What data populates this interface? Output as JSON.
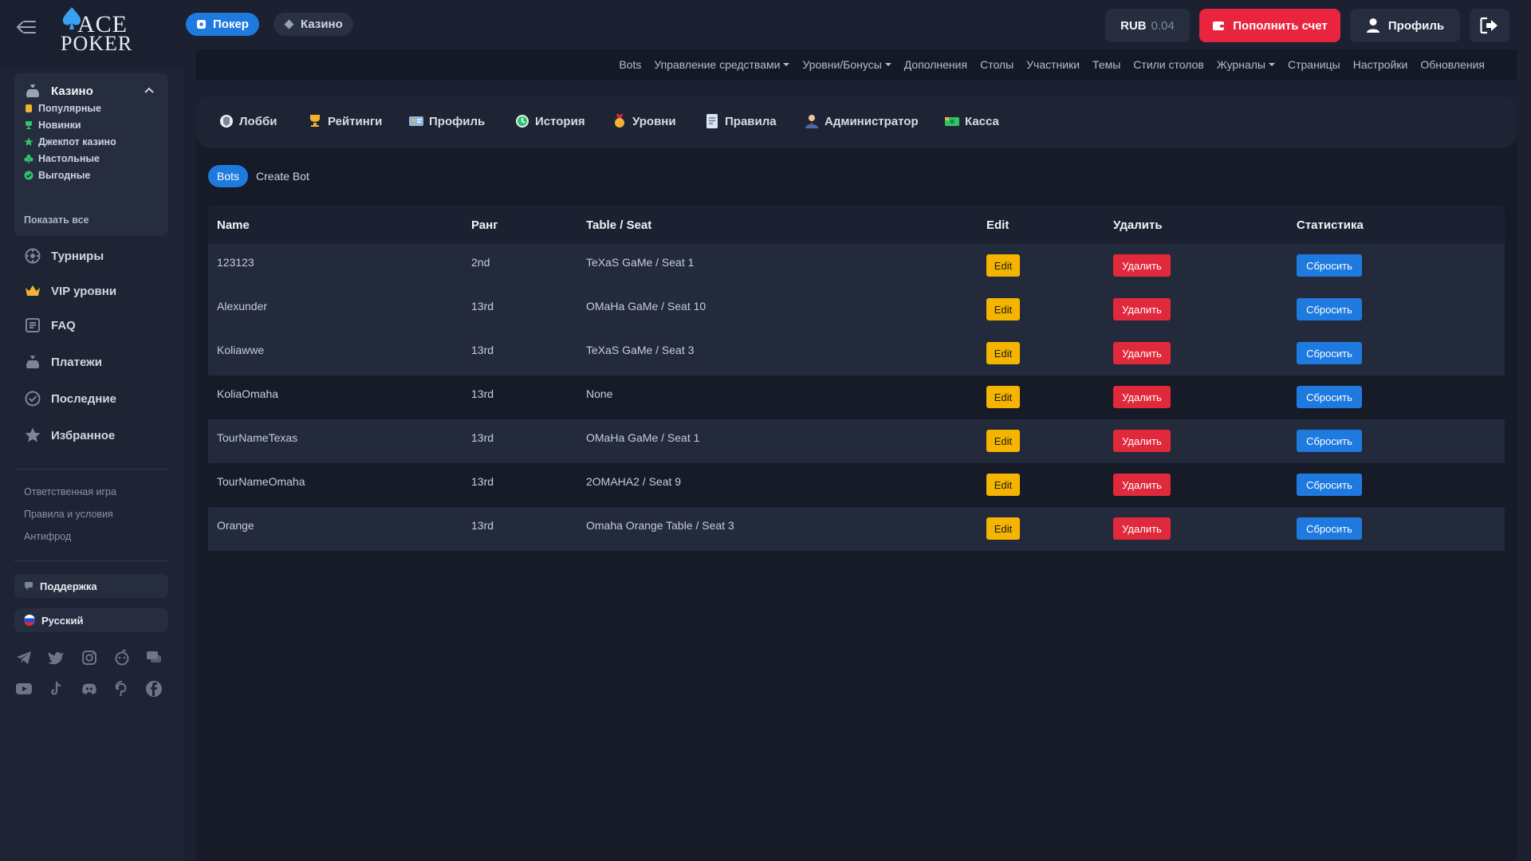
{
  "brand": {
    "logo_top": "ACE",
    "logo_bottom": "POKER"
  },
  "topbar": {
    "tabs": [
      {
        "label": "Покер",
        "icon": "poker-chip-icon"
      },
      {
        "label": "Казино",
        "icon": "diamond-icon"
      }
    ],
    "balance": {
      "currency": "RUB",
      "amount": "0.04"
    },
    "deposit_label": "Пополнить счет",
    "profile_label": "Профиль"
  },
  "sidebar": {
    "casino": {
      "label": "Казино",
      "items": [
        {
          "label": "Популярные",
          "icon": "popular-icon"
        },
        {
          "label": "Новинки",
          "icon": "trophy-icon"
        },
        {
          "label": "Джекпот казино",
          "icon": "star-icon"
        },
        {
          "label": "Настольные",
          "icon": "club-icon"
        },
        {
          "label": "Выгодные",
          "icon": "check-icon"
        }
      ],
      "show_all": "Показать все"
    },
    "nav": [
      {
        "label": "Турниры",
        "icon": "tournament-icon"
      },
      {
        "label": "VIP уровни",
        "icon": "crown-icon"
      },
      {
        "label": "FAQ",
        "icon": "faq-icon"
      },
      {
        "label": "Платежи",
        "icon": "money-bag-icon"
      },
      {
        "label": "Последние",
        "icon": "recent-icon"
      },
      {
        "label": "Избранное",
        "icon": "star-icon"
      }
    ],
    "footer_links": [
      "Ответственная игра",
      "Правила и условия",
      "Антифрод"
    ],
    "support_label": "Поддержка",
    "language_label": "Русский",
    "social_icons": [
      "telegram-icon",
      "twitter-icon",
      "instagram-icon",
      "reddit-icon",
      "chat-icon",
      "youtube-icon",
      "tiktok-icon",
      "discord-icon",
      "pinterest-icon",
      "facebook-icon"
    ]
  },
  "admin_menu": [
    {
      "label": "Bots",
      "dropdown": false
    },
    {
      "label": "Управление средствами",
      "dropdown": true
    },
    {
      "label": "Уровни/Бонусы",
      "dropdown": true
    },
    {
      "label": "Дополнения",
      "dropdown": false
    },
    {
      "label": "Столы",
      "dropdown": false
    },
    {
      "label": "Участники",
      "dropdown": false
    },
    {
      "label": "Темы",
      "dropdown": false
    },
    {
      "label": "Стили столов",
      "dropdown": false
    },
    {
      "label": "Журналы",
      "dropdown": true
    },
    {
      "label": "Страницы",
      "dropdown": false
    },
    {
      "label": "Настройки",
      "dropdown": false
    },
    {
      "label": "Обновления",
      "dropdown": false
    }
  ],
  "sections": [
    {
      "label": "Лобби",
      "icon": "lobby-icon"
    },
    {
      "label": "Рейтинги",
      "icon": "trophy-icon"
    },
    {
      "label": "Профиль",
      "icon": "id-card-icon"
    },
    {
      "label": "История",
      "icon": "history-icon"
    },
    {
      "label": "Уровни",
      "icon": "medal-icon"
    },
    {
      "label": "Правила",
      "icon": "rules-icon"
    },
    {
      "label": "Администратор",
      "icon": "admin-icon"
    },
    {
      "label": "Касса",
      "icon": "cash-icon"
    }
  ],
  "subtabs": {
    "active": "Bots",
    "other": "Create Bot"
  },
  "table": {
    "headers": {
      "name": "Name",
      "rank": "Ранг",
      "table_seat": "Table / Seat",
      "edit": "Edit",
      "delete": "Удалить",
      "stats": "Статистика"
    },
    "buttons": {
      "edit": "Edit",
      "delete": "Удалить",
      "reset": "Сбросить"
    },
    "rows": [
      {
        "name": "123123",
        "rank": "2nd",
        "table_seat": "TeXaS GaMe / Seat 1"
      },
      {
        "name": "Alexunder",
        "rank": "13rd",
        "table_seat": "OMaHa GaMe / Seat 10"
      },
      {
        "name": "Koliawwe",
        "rank": "13rd",
        "table_seat": "TeXaS GaMe / Seat 3"
      },
      {
        "name": "KoliaOmaha",
        "rank": "13rd",
        "table_seat": "None"
      },
      {
        "name": "TourNameTexas",
        "rank": "13rd",
        "table_seat": "OMaHa GaMe / Seat 1"
      },
      {
        "name": "TourNameOmaha",
        "rank": "13rd",
        "table_seat": "2OMAHA2 / Seat 9"
      },
      {
        "name": "Orange",
        "rank": "13rd",
        "table_seat": "Omaha Orange Table / Seat 3"
      }
    ]
  },
  "colors": {
    "accent_blue": "#1f7ae0",
    "danger_red": "#e02a3c",
    "deposit_red": "#e8243f",
    "edit_yellow": "#f5b400"
  }
}
